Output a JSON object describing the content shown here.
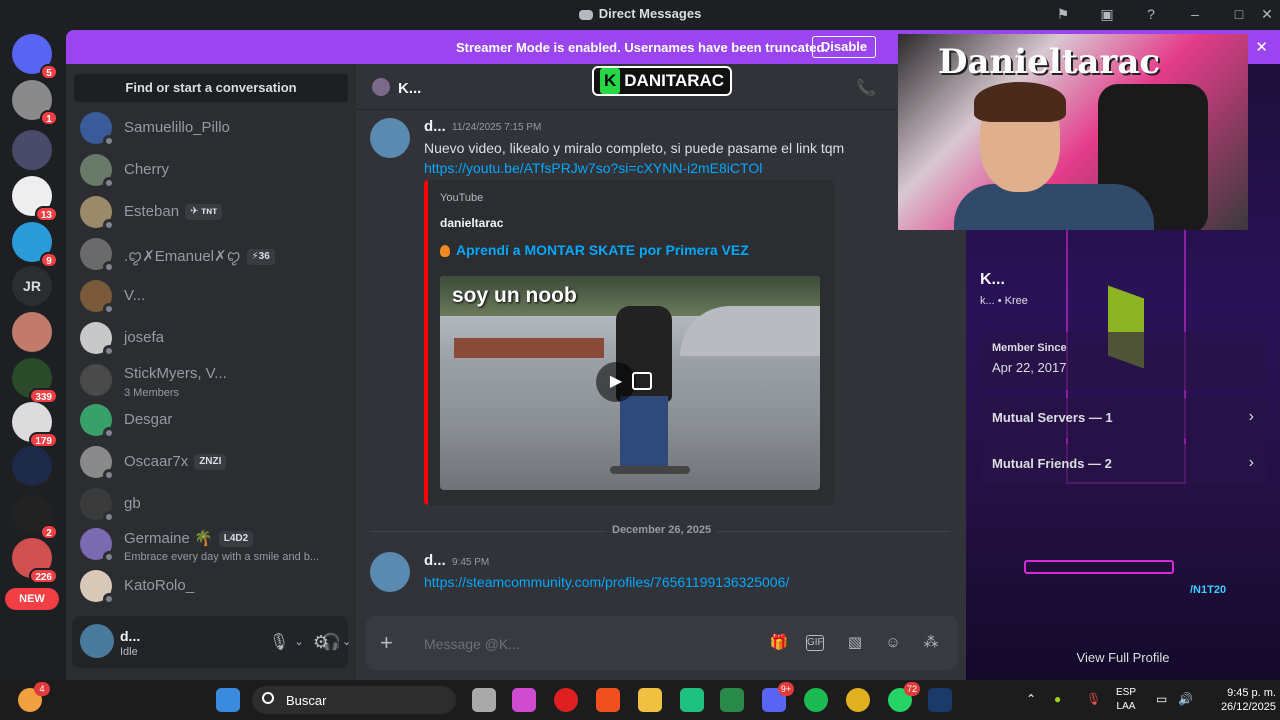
{
  "window": {
    "title": "Direct Messages"
  },
  "banner": {
    "message": "Streamer Mode is enabled. Usernames have been truncated.",
    "button": "Disable"
  },
  "servers": [
    {
      "badge": "5"
    },
    {
      "badge": "1"
    },
    {
      "badge": ""
    },
    {
      "badge": "13"
    },
    {
      "badge": "9"
    },
    {
      "label": "JR"
    },
    {
      "badge": ""
    },
    {
      "badge": "339"
    },
    {
      "badge": "179"
    },
    {
      "badge": ""
    },
    {
      "badge": "2"
    },
    {
      "badge": "226"
    },
    {
      "label": "NEW"
    }
  ],
  "dm": {
    "find_label": "Find or start a conversation",
    "items": [
      {
        "name": "Samuelillo_Pillo"
      },
      {
        "name": "Cherry"
      },
      {
        "name": "Esteban",
        "tag": "✈ ᴛɴᴛ"
      },
      {
        "name": ".ꨄ✗Emanuel✗ꨄ",
        "tag": "⚡36"
      },
      {
        "name": "V..."
      },
      {
        "name": "josefa"
      },
      {
        "name": "StickMyers, V...",
        "sub": "3 Members"
      },
      {
        "name": "Desgar"
      },
      {
        "name": "Oscaar7x",
        "tag": "ZNZI"
      },
      {
        "name": "gb"
      },
      {
        "name": "Germaine 🌴",
        "tag": "L4D2",
        "sub": "Embrace every day with a smile and b..."
      },
      {
        "name": "KatoRolo_"
      }
    ]
  },
  "user": {
    "name": "d...",
    "status": "Idle"
  },
  "chat": {
    "header_name": "K...",
    "channel_logo": "DANITARAC",
    "messages": [
      {
        "author": "d...",
        "time": "11/24/2025 7:15 PM",
        "text": "Nuevo video, likealo y miralo completo, si puede pasame el link tqm",
        "link": "https://youtu.be/ATfsPRJw7so?si=cXYNN-i2mE8iCTOl",
        "embed": {
          "provider": "YouTube",
          "author": "danieltarac",
          "title": "Aprendí a MONTAR SKATE por Primera VEZ",
          "thumb_text": "soy un noob"
        }
      },
      {
        "author": "d...",
        "time": "9:45 PM",
        "link": "https://steamcommunity.com/profiles/76561199136325006/"
      }
    ],
    "date_divider": "December 26, 2025",
    "composer_placeholder": "Message @K..."
  },
  "profile": {
    "name": "K...",
    "username": "k... • Kree",
    "member_since_label": "Member Since",
    "member_since": "Apr 22, 2017",
    "mutual_servers": "Mutual Servers — 1",
    "mutual_friends": "Mutual Friends — 2",
    "view_full": "View Full Profile",
    "tag": "/N1T20"
  },
  "webcam": {
    "graffiti": "Danieltarac"
  },
  "taskbar": {
    "search": "Buscar",
    "lang_line1": "ESP",
    "lang_line2": "LAA",
    "time": "9:45 p. m.",
    "date": "26/12/2025",
    "discord_badge": "9+",
    "whatsapp_badge": "72",
    "left_badge": "4"
  },
  "colors": {
    "accent": "#9b45f0",
    "link": "#00a8fc",
    "badge": "#f23f43",
    "youtube": "#ff0000"
  }
}
